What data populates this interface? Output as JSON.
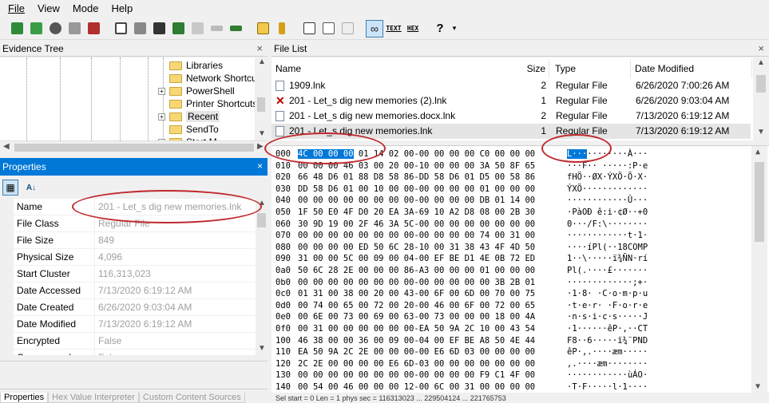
{
  "menu": [
    "File",
    "View",
    "Mode",
    "Help"
  ],
  "toolbar": {
    "text_label": "TEXT",
    "hex_label": "HEX",
    "help_glyph": "?"
  },
  "evidence_tree": {
    "title": "Evidence Tree",
    "close": "×",
    "items": [
      {
        "label": "Libraries",
        "expander": ""
      },
      {
        "label": "Network Shortcuts",
        "expander": ""
      },
      {
        "label": "PowerShell",
        "expander": "+"
      },
      {
        "label": "Printer Shortcuts",
        "expander": ""
      },
      {
        "label": "Recent",
        "expander": "+",
        "selected": true
      },
      {
        "label": "SendTo",
        "expander": ""
      },
      {
        "label": "Start M",
        "expander": "+"
      }
    ]
  },
  "properties": {
    "title": "Properties",
    "close": "×",
    "rows": [
      {
        "name": "Name",
        "value": "201 - Let_s dig new memories.lnk"
      },
      {
        "name": "File Class",
        "value": "Regular File"
      },
      {
        "name": "File Size",
        "value": "849"
      },
      {
        "name": "Physical Size",
        "value": "4,096"
      },
      {
        "name": "Start Cluster",
        "value": "116,313,023"
      },
      {
        "name": "Date Accessed",
        "value": "7/13/2020 6:19:12 AM"
      },
      {
        "name": "Date Created",
        "value": "6/26/2020 9:03:04 AM"
      },
      {
        "name": "Date Modified",
        "value": "7/13/2020 6:19:12 AM"
      },
      {
        "name": "Encrypted",
        "value": "False"
      },
      {
        "name": "Compressed",
        "value": "False"
      }
    ],
    "tabs": [
      "Properties",
      "Hex Value Interpreter",
      "Custom Content Sources"
    ]
  },
  "file_list": {
    "title": "File List",
    "close": "×",
    "columns": {
      "name": "Name",
      "size": "Size",
      "type": "Type",
      "modified": "Date Modified"
    },
    "rows": [
      {
        "name": "1909.lnk",
        "size": "2",
        "type": "Regular File",
        "modified": "6/26/2020 7:00:26 AM",
        "icon": "file-icon"
      },
      {
        "name": "201 - Let_s dig new memories (2).lnk",
        "size": "1",
        "type": "Regular File",
        "modified": "6/26/2020 9:03:04 AM",
        "icon": "deleted-file-icon"
      },
      {
        "name": "201 - Let_s dig new memories.docx.lnk",
        "size": "2",
        "type": "Regular File",
        "modified": "7/13/2020 6:19:12 AM",
        "icon": "file-icon"
      },
      {
        "name": "201 - Let_s dig new memories.lnk",
        "size": "1",
        "type": "Regular File",
        "modified": "7/13/2020 6:19:12 AM",
        "icon": "file-icon",
        "selected": true
      }
    ]
  },
  "hex_view": {
    "rows": [
      {
        "off": "000",
        "bytes": "4C 00 00 00 01 14 02 00-00 00 00 00 C0 00 00 00",
        "ascii": "L···········À···"
      },
      {
        "off": "010",
        "bytes": "00 00 00 46 03 00 20 00-10 00 00 00 3A 50 8F 65",
        "ascii": "···F·· ·····:P·e"
      },
      {
        "off": "020",
        "bytes": "66 48 D6 01 88 D8 58 86-DD 58 D6 01 D5 00 58 86",
        "ascii": "fHÖ··ØX·ÝXÖ·Õ·X·"
      },
      {
        "off": "030",
        "bytes": "DD 58 D6 01 00 10 00 00-00 00 00 00 01 00 00 00",
        "ascii": "ÝXÖ·············"
      },
      {
        "off": "040",
        "bytes": "00 00 00 00 00 00 00 00-00 00 00 00 DB 01 14 00",
        "ascii": "············Û···"
      },
      {
        "off": "050",
        "bytes": "1F 50 E0 4F D0 20 EA 3A-69 10 A2 D8 08 00 2B 30",
        "ascii": "·PàOÐ ê:i·¢Ø··+0"
      },
      {
        "off": "060",
        "bytes": "30 9D 19 00 2F 46 3A 5C-00 00 00 00 00 00 00 00",
        "ascii": "0···/F:\\········"
      },
      {
        "off": "070",
        "bytes": "00 00 00 00 00 00 00 00-00 00 00 00 74 00 31 00",
        "ascii": "············t·1·"
      },
      {
        "off": "080",
        "bytes": "00 00 00 00 ED 50 6C 28-10 00 31 38 43 4F 4D 50",
        "ascii": "····íPl(··18COMP"
      },
      {
        "off": "090",
        "bytes": "31 00 00 5C 00 09 00 04-00 EF BE D1 4E 0B 72 ED",
        "ascii": "1··\\·····ï¾ÑN·rí"
      },
      {
        "off": "0a0",
        "bytes": "50 6C 28 2E 00 00 00 86-A3 00 00 00 01 00 00 00",
        "ascii": "Pl(.····£·······"
      },
      {
        "off": "0b0",
        "bytes": "00 00 00 00 00 00 00 00-00 00 00 00 00 3B 2B 01",
        "ascii": "·············;+·"
      },
      {
        "off": "0c0",
        "bytes": "01 31 00 38 00 20 00 43-00 6F 00 6D 00 70 00 75",
        "ascii": "·1·8· ·C·o·m·p·u"
      },
      {
        "off": "0d0",
        "bytes": "00 74 00 65 00 72 00 20-00 46 00 6F 00 72 00 65",
        "ascii": "·t·e·r· ·F·o·r·e"
      },
      {
        "off": "0e0",
        "bytes": "00 6E 00 73 00 69 00 63-00 73 00 00 00 18 00 4A",
        "ascii": "·n·s·i·c·s·····J"
      },
      {
        "off": "0f0",
        "bytes": "00 31 00 00 00 00 00 00-EA 50 9A 2C 10 00 43 54",
        "ascii": "·1······êP·,··CT"
      },
      {
        "off": "100",
        "bytes": "46 38 00 00 36 00 09 00-04 00 EF BE A8 50 4E 44",
        "ascii": "F8··6·····ï¾¨PND"
      },
      {
        "off": "110",
        "bytes": "EA 50 9A 2C 2E 00 00 00-00 E6 6D 03 00 00 00 00",
        "ascii": "êP·,.····æm·····"
      },
      {
        "off": "120",
        "bytes": "2C 2E 00 00 00 00 E6 6D-03 00 00 00 00 00 00 00",
        "ascii": ",.····æm········"
      },
      {
        "off": "130",
        "bytes": "00 00 00 00 00 00 00 00-00 00 00 00 F9 C1 4F 00",
        "ascii": "············ùÁO·"
      },
      {
        "off": "140",
        "bytes": "00 54 00 46 00 00 00 12-00 6C 00 31 00 00 00 00",
        "ascii": "·T·F·····l·1····"
      }
    ]
  },
  "status": "Sel start = 0   Len = 1   phys sec = 116313023   ...   229504124 ...   221765753"
}
